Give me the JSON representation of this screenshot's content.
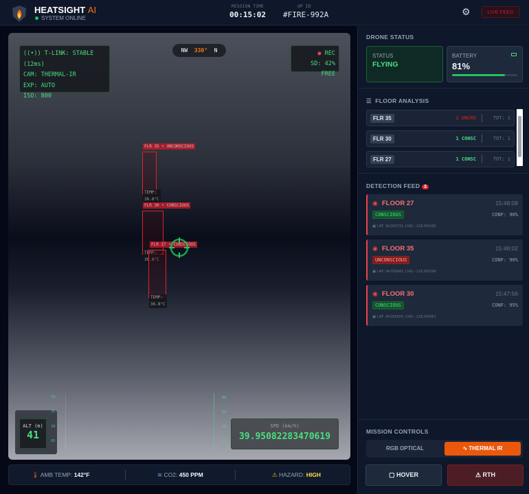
{
  "header": {
    "app_name": "HEATSIGHT",
    "app_suffix": "AI",
    "system_status": "SYSTEM ONLINE",
    "mission_time_label": "MISSION TIME",
    "mission_time": "00:15:02",
    "op_id_label": "OP ID",
    "op_id": "#FIRE-992A",
    "live_feed_label": "LIVE FEED"
  },
  "feed": {
    "telemetry": [
      "T-LINK: STABLE (12ms)",
      "CAM: THERMAL-IR",
      "EXP: AUTO",
      "ISO: 800"
    ],
    "compass": {
      "left": "NW",
      "heading": "330°",
      "right": "N"
    },
    "rec": {
      "label": "REC",
      "sd": "SD: 42% FREE"
    },
    "detections": [
      {
        "label": "FLR 35 • UNCONSCIOUS",
        "temp_label": "TEMP:",
        "temp": "36.8°C"
      },
      {
        "label": "FLR 30 • CONSCIOUS",
        "temp_label": "TEMP:",
        "temp": "36.8°C"
      },
      {
        "label": "FLR 27 • CONSCIOUS",
        "temp_label": "TEMP:",
        "temp": "36.8°C"
      }
    ],
    "alt_ticks": [
      "50",
      "35",
      "20",
      "05"
    ],
    "spd_ticks": [
      "80",
      "60",
      "40",
      "20"
    ],
    "alt_label": "ALT (m)",
    "alt_value": "41",
    "spd_label": "SPD (km/h)",
    "spd_value": "39.95082283470619"
  },
  "env": {
    "temp_label": "AMB TEMP:",
    "temp": "142°F",
    "co2_label": "CO2:",
    "co2": "450 PPM",
    "hazard_label": "HAZARD:",
    "hazard": "HIGH"
  },
  "sidebar": {
    "drone_status_title": "DRONE STATUS",
    "status_label": "STATUS",
    "status": "FLYING",
    "battery_label": "BATTERY",
    "battery": "81%",
    "battery_level": 0.81,
    "floor_title": "FLOOR ANALYSIS",
    "floors": [
      {
        "floor": "FLR 35",
        "count": "1 UNCNS",
        "total": "TOT: 1",
        "color": "#b91c1c"
      },
      {
        "floor": "FLR 30",
        "count": "1 CONSC",
        "total": "TOT: 1",
        "color": "#4ade80"
      },
      {
        "floor": "FLR 27",
        "count": "1 CONSC",
        "total": "TOT: 1",
        "color": "#4ade80"
      }
    ],
    "detection_title": "DETECTION FEED",
    "detection_count": "3",
    "detections": [
      {
        "floor": "FLOOR 27",
        "time": "15:48:08",
        "state": "CONSCIOUS",
        "conf": "CONF: 90%",
        "coords": "LAT: 34.052731, LNG: -118.243182"
      },
      {
        "floor": "FLOOR 35",
        "time": "15:48:02",
        "state": "UNCONSCIOUS",
        "conf": "CONF: 90%",
        "coords": "LAT: 34.052842, LNG: -118.243184"
      },
      {
        "floor": "FLOOR 30",
        "time": "15:47:56",
        "state": "CONSCIOUS",
        "conf": "CONF: 95%",
        "coords": "LAT: 34.052629, LNG: -118.243661"
      }
    ],
    "controls_title": "MISSION CONTROLS",
    "rgb_label": "RGB OPTICAL",
    "thermal_label": "THERMAL IR",
    "hover_label": "HOVER",
    "rth_label": "RTH"
  },
  "colors": {
    "accent": "#ea580c",
    "ok": "#4ade80",
    "danger": "#ef4444"
  }
}
